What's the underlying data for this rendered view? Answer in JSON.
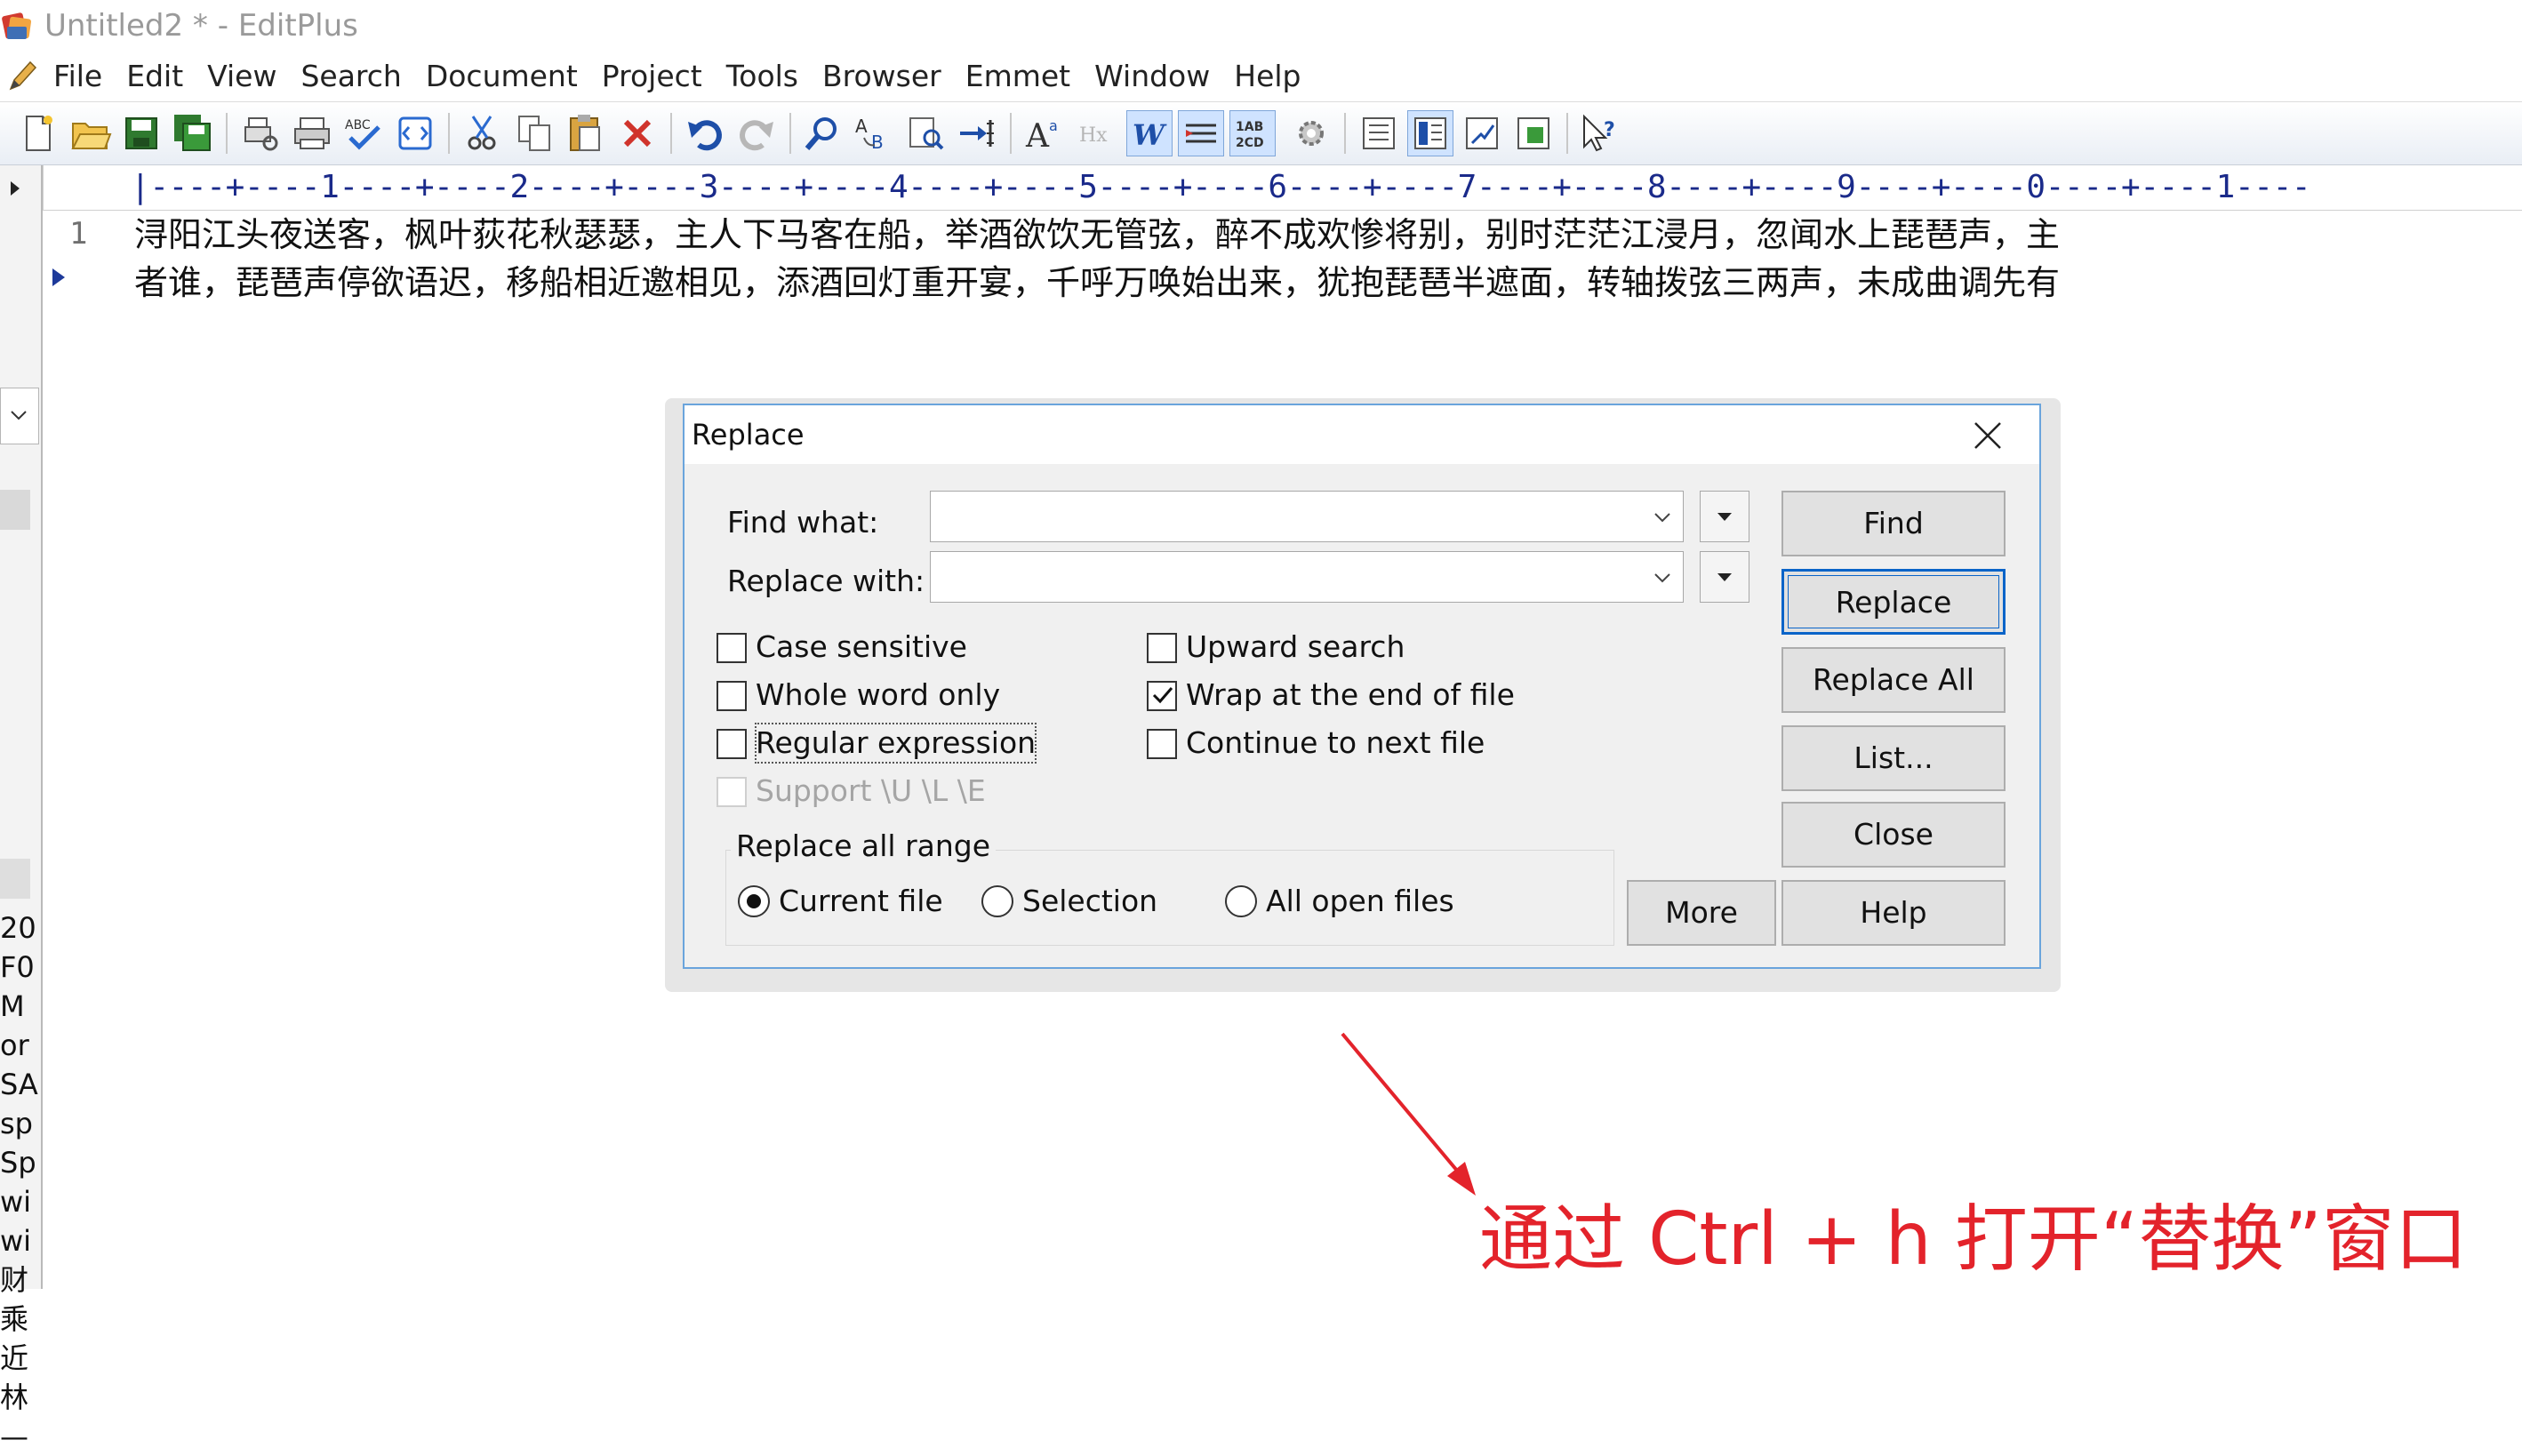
{
  "window": {
    "title": "Untitled2 * - EditPlus"
  },
  "menu": {
    "items": [
      "File",
      "Edit",
      "View",
      "Search",
      "Document",
      "Project",
      "Tools",
      "Browser",
      "Emmet",
      "Window",
      "Help"
    ]
  },
  "toolbar": {
    "icons": [
      "new-file-icon",
      "open-folder-icon",
      "save-icon",
      "save-all-icon",
      "print-preview-icon",
      "print-icon",
      "spell-check-icon",
      "browser-preview-icon",
      "cut-icon",
      "copy-icon",
      "paste-icon",
      "delete-icon",
      "undo-icon",
      "redo-icon",
      "find-icon",
      "replace-icon",
      "find-in-files-icon",
      "goto-line-icon",
      "font-icon",
      "hex-icon",
      "word-wrap-icon",
      "line-number-icon",
      "column-selection-icon",
      "settings-gear-icon",
      "cliptext-panel-icon",
      "directory-panel-icon",
      "output-window-icon",
      "fullscreen-icon",
      "help-pointer-icon"
    ]
  },
  "ruler": {
    "text": "|----+----1----+----2----+----3----+----4----+----5----+----6----+----7----+----8----+----9----+----0----+----1----"
  },
  "editor": {
    "line_number": "1",
    "lines": [
      "浔阳江头夜送客，枫叶荻花秋瑟瑟，主人下马客在船，举酒欲饮无管弦，醉不成欢惨将别，别时茫茫江浸月，忽闻水上琵琶声，主",
      "者谁，琵琶声停欲语迟，移船相近邀相见，添酒回灯重开宴，千呼万唤始出来，犹抱琵琶半遮面，转轴拨弦三两声，未成曲调先有"
    ]
  },
  "side_panel": {
    "rows": [
      "20",
      "F0",
      "M",
      "or",
      "SA",
      "sp",
      "Sp",
      "wi",
      "wi",
      "财",
      "乘",
      "近",
      "林",
      "—"
    ]
  },
  "dialog": {
    "title": "Replace",
    "find_label": "Find what:",
    "find_value": "",
    "replace_label": "Replace with:",
    "replace_value": "",
    "options": {
      "case_sensitive": {
        "label": "Case sensitive",
        "checked": false
      },
      "whole_word": {
        "label": "Whole word only",
        "checked": false
      },
      "regex": {
        "label": "Regular expression",
        "checked": false
      },
      "support_ule": {
        "label": "Support \\U \\L \\E",
        "checked": false,
        "disabled": true
      },
      "upward": {
        "label": "Upward search",
        "checked": false
      },
      "wrap": {
        "label": "Wrap at the end of file",
        "checked": true
      },
      "continue_next": {
        "label": "Continue to next file",
        "checked": false
      }
    },
    "range": {
      "title": "Replace all range",
      "current_file": "Current file",
      "selection": "Selection",
      "all_open": "All open files",
      "selected": "current_file"
    },
    "buttons": {
      "find": "Find",
      "replace": "Replace",
      "replace_all": "Replace All",
      "list": "List...",
      "close": "Close",
      "help": "Help",
      "more": "More"
    }
  },
  "annotation": {
    "text": "通过 Ctrl + h 打开“替换”窗口"
  },
  "colors": {
    "accent": "#0a64c8",
    "annotation": "#e3232b",
    "dialog_border": "#6aa4dc"
  }
}
